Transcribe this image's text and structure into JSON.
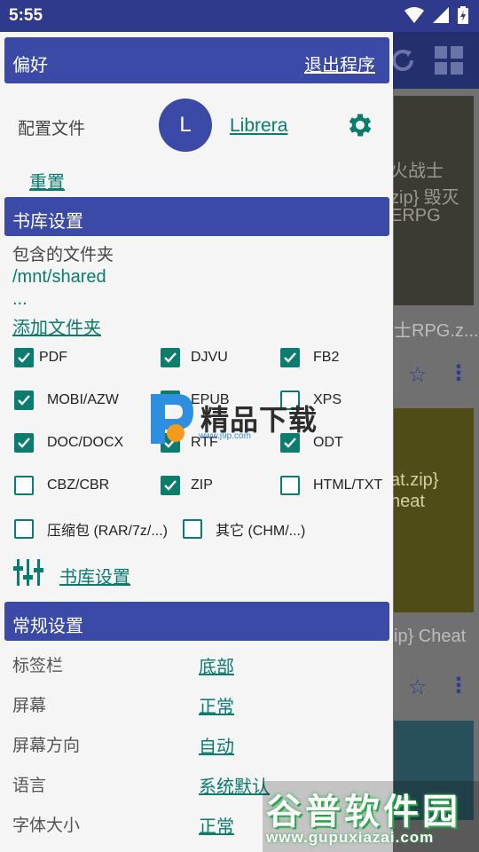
{
  "status": {
    "time": "5:55"
  },
  "header": {
    "title": "偏好",
    "exit_label": "退出程序"
  },
  "profile": {
    "label": "配置文件",
    "avatar_letter": "L",
    "name": "Librera",
    "reset_label": "重置"
  },
  "library": {
    "title": "书库设置",
    "folders_label": "包含的文件夹",
    "folder_path": "/mnt/shared",
    "folder_more": "...",
    "add_folder_label": "添加文件夹",
    "formats": [
      {
        "label": "PDF",
        "checked": true
      },
      {
        "label": "DJVU",
        "checked": true
      },
      {
        "label": "FB2",
        "checked": true
      },
      {
        "label": "MOBI/AZW",
        "checked": true
      },
      {
        "label": "EPUB",
        "checked": true
      },
      {
        "label": "XPS",
        "checked": false
      },
      {
        "label": "DOC/DOCX",
        "checked": true
      },
      {
        "label": "RTF",
        "checked": true
      },
      {
        "label": "ODT",
        "checked": true
      },
      {
        "label": "CBZ/CBR",
        "checked": false
      },
      {
        "label": "ZIP",
        "checked": true
      },
      {
        "label": "HTML/TXT",
        "checked": false
      },
      {
        "label": "压缩包 (RAR/7z/...)",
        "checked": false
      },
      {
        "label": "其它 (CHM/...)",
        "checked": false
      }
    ],
    "settings_link": "书库设置"
  },
  "general": {
    "title": "常规设置",
    "rows": [
      {
        "label": "标签栏",
        "value": "底部"
      },
      {
        "label": "屏幕",
        "value": "正常"
      },
      {
        "label": "屏幕方向",
        "value": "自动"
      },
      {
        "label": "语言",
        "value": "系统默认"
      },
      {
        "label": "字体大小",
        "value": "正常"
      }
    ]
  },
  "background": {
    "book1_lines": [
      "火战士",
      "zip} 毁灭",
      "ERPG"
    ],
    "book1_filename": "士RPG.z...",
    "book2_lines": [
      "at.zip}",
      "heat"
    ],
    "book2_filename": "ip} Cheat"
  },
  "watermarks": {
    "wm1_text": "精品下载",
    "wm1_url": "www.j9p.com",
    "wm2_text": "谷普软件园",
    "wm2_url": "www.gupuxiazai.com"
  },
  "colors": {
    "primary": "#3a4aa6",
    "accent": "#0a7d6e",
    "statusbar": "#2f3a8c"
  }
}
